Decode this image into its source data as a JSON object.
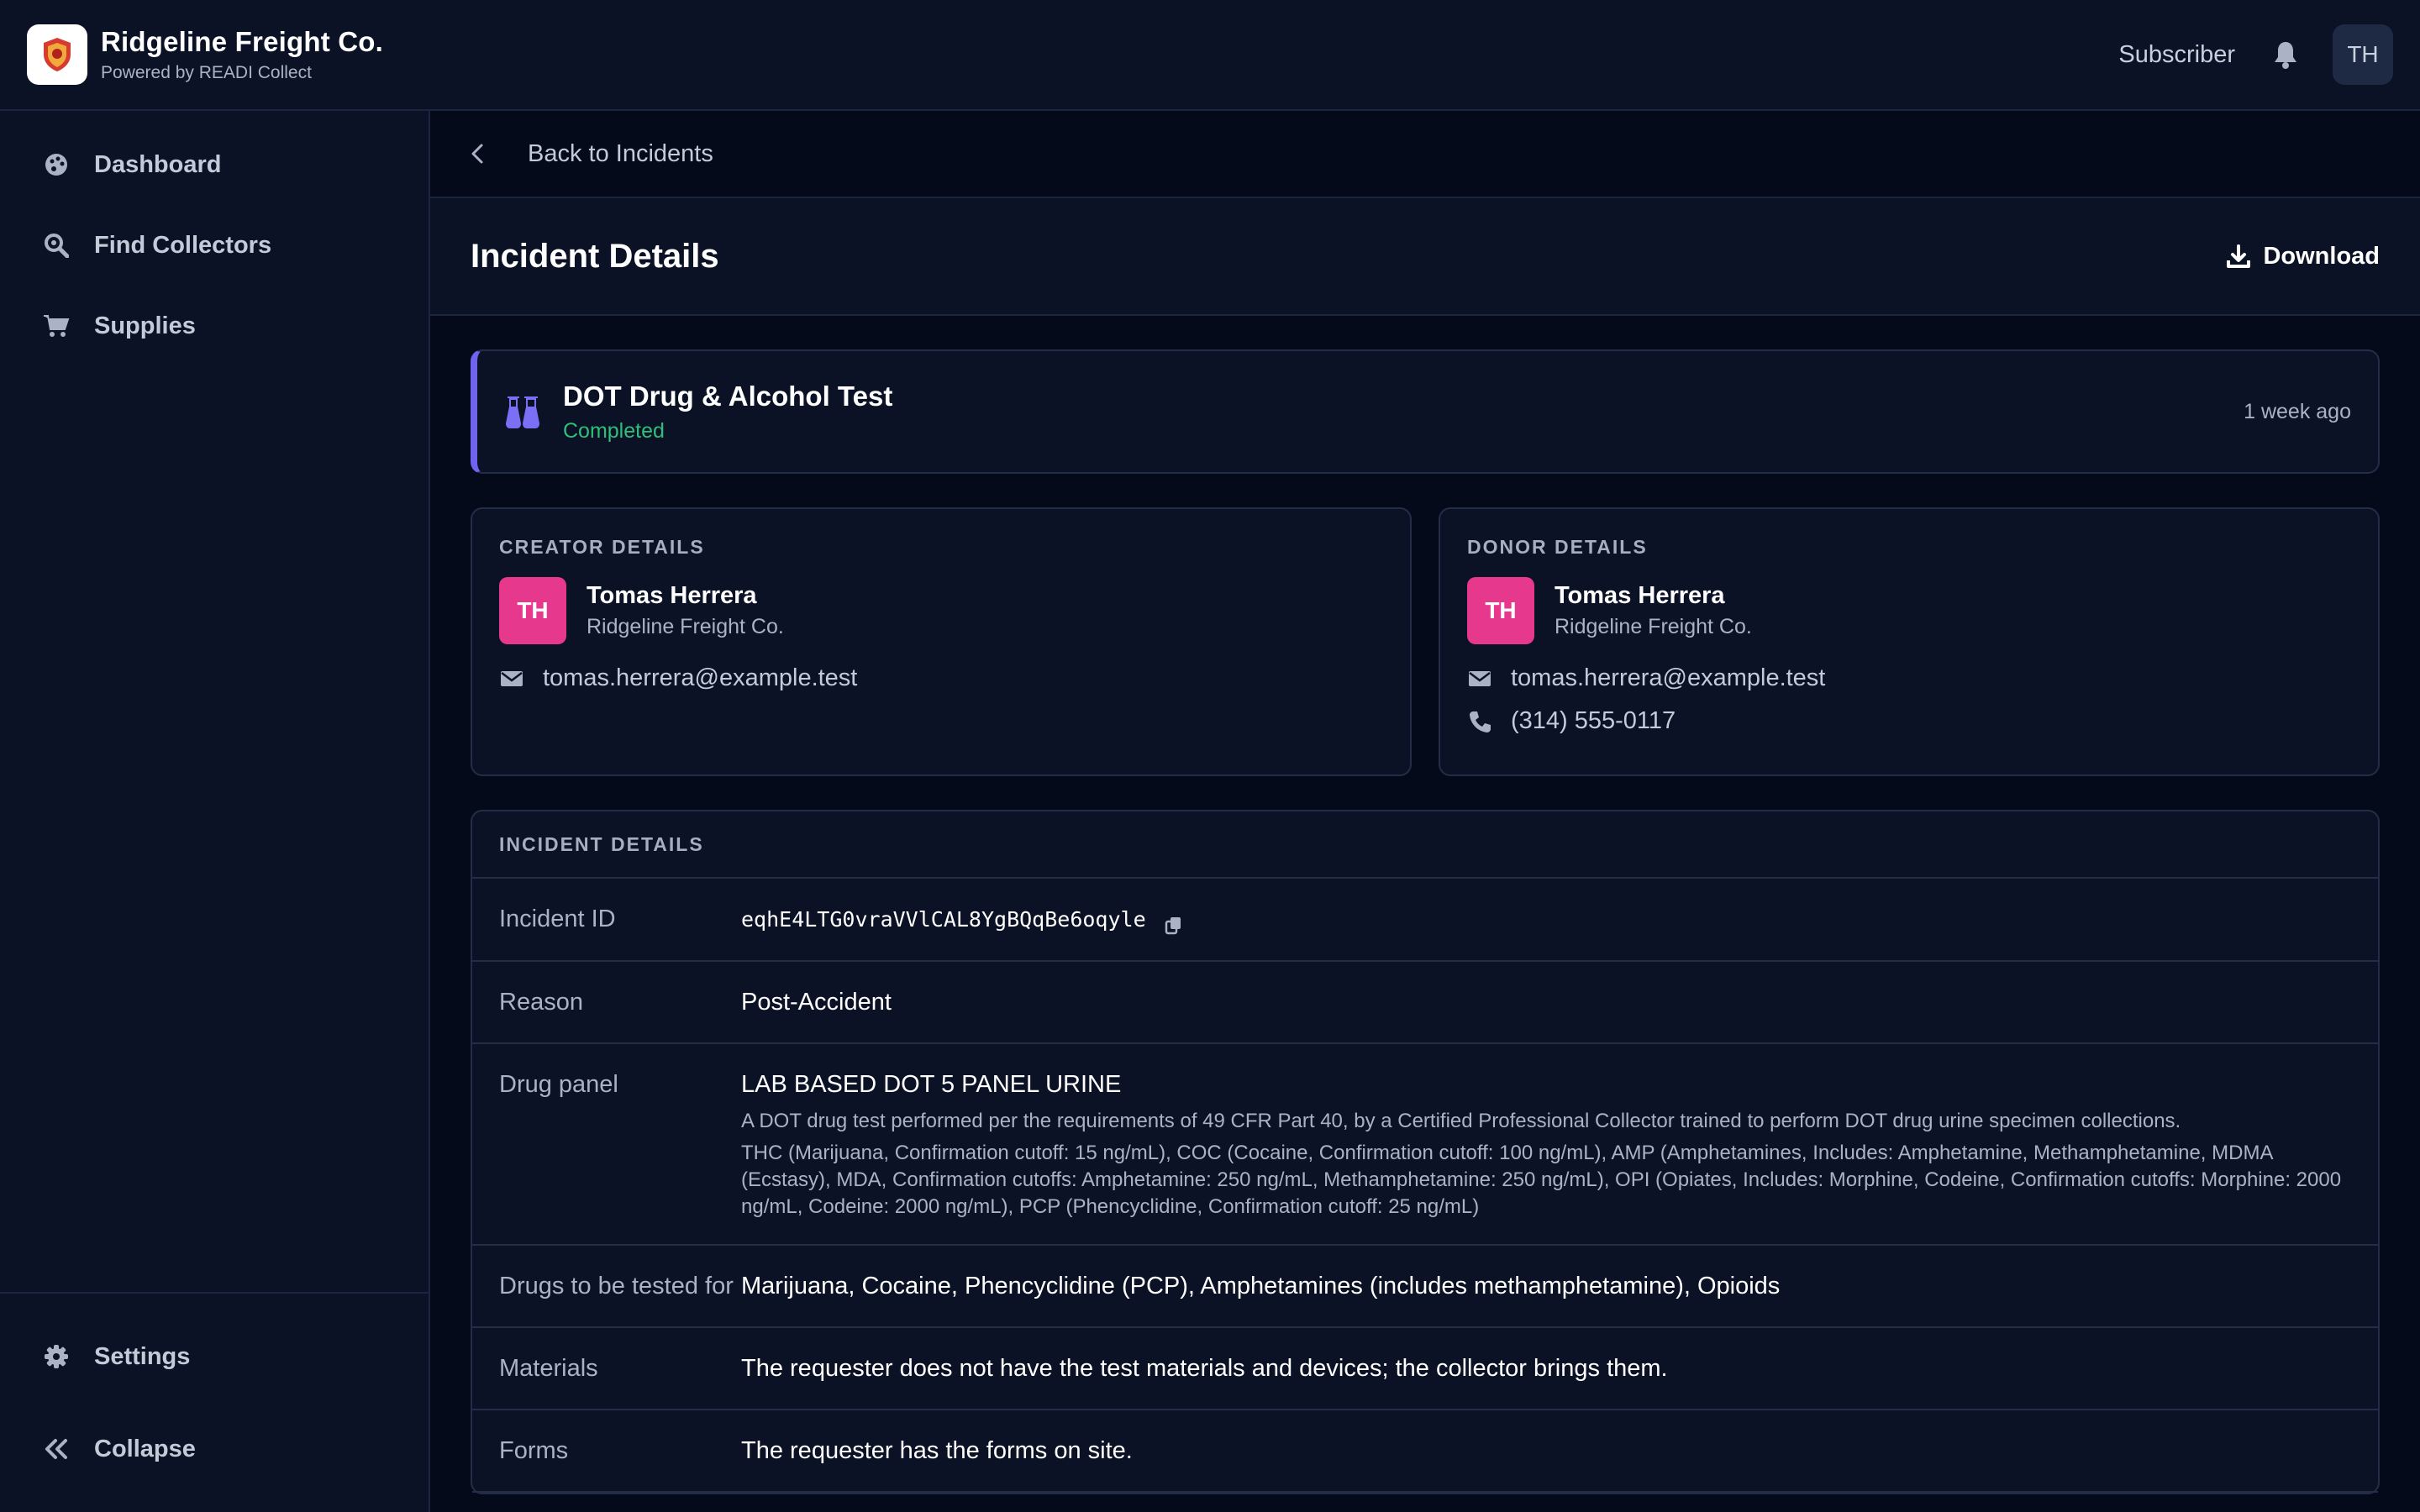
{
  "app": {
    "title": "Ridgeline Freight Co.",
    "subtitle": "Powered by READI Collect",
    "role": "Subscriber",
    "user_initials": "TH"
  },
  "sidebar": {
    "items": [
      {
        "label": "Dashboard",
        "icon": "palette-icon"
      },
      {
        "label": "Find Collectors",
        "icon": "search-icon"
      },
      {
        "label": "Supplies",
        "icon": "cart-icon"
      }
    ],
    "settings_label": "Settings",
    "collapse_label": "Collapse"
  },
  "main": {
    "back_label": "Back to Incidents",
    "title": "Incident Details",
    "download_label": "Download"
  },
  "test": {
    "name": "DOT Drug & Alcohol Test",
    "status": "Completed",
    "time": "1 week ago"
  },
  "creator": {
    "label": "CREATOR DETAILS",
    "initials": "TH",
    "name": "Tomas Herrera",
    "org": "Ridgeline Freight Co.",
    "email": "tomas.herrera@example.test"
  },
  "donor": {
    "label": "DONOR DETAILS",
    "initials": "TH",
    "name": "Tomas Herrera",
    "org": "Ridgeline Freight Co.",
    "email": "tomas.herrera@example.test",
    "phone": "(314) 555-0117"
  },
  "details": {
    "label": "INCIDENT DETAILS",
    "incident_id_label": "Incident ID",
    "incident_id": "eqhE4LTG0vraVVlCAL8YgBQqBe6oqyle",
    "reason_label": "Reason",
    "reason": "Post-Accident",
    "panel_label": "Drug panel",
    "panel_name": "LAB BASED DOT 5 PANEL URINE",
    "panel_desc": "A DOT drug test performed per the requirements of 49 CFR Part 40, by a Certified Professional Collector trained to perform DOT drug urine specimen collections.",
    "panel_cutoffs": "THC (Marijuana, Confirmation cutoff: 15 ng/mL), COC (Cocaine, Confirmation cutoff: 100 ng/mL), AMP (Amphetamines, Includes: Amphetamine, Methamphetamine, MDMA (Ecstasy), MDA, Confirmation cutoffs: Amphetamine: 250 ng/mL, Methamphetamine: 250 ng/mL), OPI (Opiates, Includes: Morphine, Codeine, Confirmation cutoffs: Morphine: 2000 ng/mL, Codeine: 2000 ng/mL), PCP (Phencyclidine, Confirmation cutoff: 25 ng/mL)",
    "drugs_label": "Drugs to be tested for",
    "drugs": "Marijuana, Cocaine, Phencyclidine (PCP), Amphetamines (includes methamphetamine), Opioids",
    "materials_label": "Materials",
    "materials": "The requester does not have the test materials and devices; the collector brings them.",
    "forms_label": "Forms",
    "forms": "The requester has the forms on site."
  },
  "colors": {
    "accent": "#6f63f0",
    "status_completed": "#2fbf7a",
    "avatar_pink": "#e6398d"
  }
}
